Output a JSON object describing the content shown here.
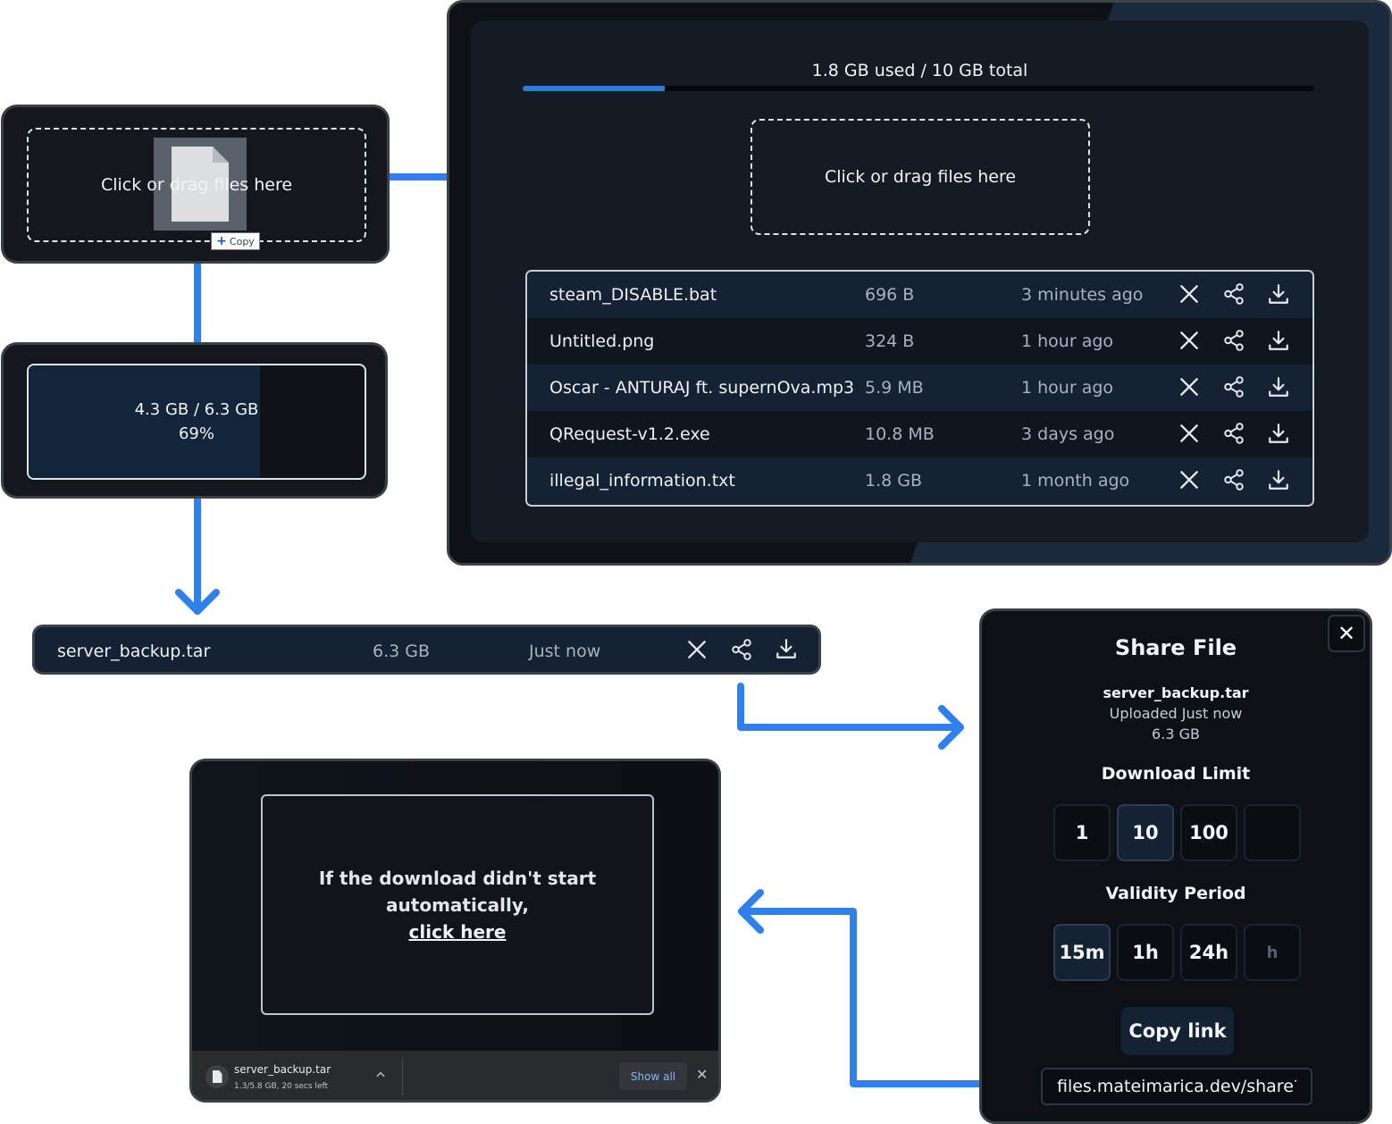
{
  "dropzone": {
    "text": "Click or drag files here",
    "copy_badge": "Copy"
  },
  "progress": {
    "text": "4.3 GB / 6.3 GB",
    "percent_label": "69%",
    "fraction": 0.69
  },
  "storage": {
    "label": "1.8 GB used / 10 GB total",
    "used_fraction": 0.18
  },
  "files": [
    {
      "name": "steam_DISABLE.bat",
      "size": "696 B",
      "date": "3 minutes ago"
    },
    {
      "name": "Untitled.png",
      "size": "324 B",
      "date": "1 hour ago"
    },
    {
      "name": "Oscar - ANTURAJ ft. supernOva.mp3",
      "size": "5.9 MB",
      "date": "1 hour ago"
    },
    {
      "name": "QRequest-v1.2.exe",
      "size": "10.8 MB",
      "date": "3 days ago"
    },
    {
      "name": "illegal_information.txt",
      "size": "1.8 GB",
      "date": "1 month ago"
    }
  ],
  "uploaded": {
    "name": "server_backup.tar",
    "size": "6.3 GB",
    "date": "Just now"
  },
  "share": {
    "title": "Share File",
    "close": "✕",
    "file_name": "server_backup.tar",
    "uploaded": "Uploaded Just now",
    "size": "6.3 GB",
    "download_limit_label": "Download Limit",
    "download_limits": [
      "1",
      "10",
      "100",
      ""
    ],
    "selected_limit": "10",
    "validity_label": "Validity Period",
    "validity_options": [
      "15m",
      "1h",
      "24h",
      "h"
    ],
    "selected_validity": "15m",
    "copy_label": "Copy link",
    "link": "files.mateimarica.dev/share?id="
  },
  "download_page": {
    "line1": "If the download didn't start",
    "line2": "automatically,",
    "link_text": "click here",
    "bar": {
      "file": "server_backup.tar",
      "progress": "1.3/5.8 GB, 20 secs left",
      "show_all": "Show all",
      "close": "✕"
    }
  },
  "colors": {
    "accent": "#2f80ed",
    "row": "#142234",
    "panel": "#14181e"
  },
  "icons": [
    "file-icon",
    "plus-icon",
    "close-icon",
    "share-icon",
    "download-icon",
    "chevron-up-icon"
  ]
}
